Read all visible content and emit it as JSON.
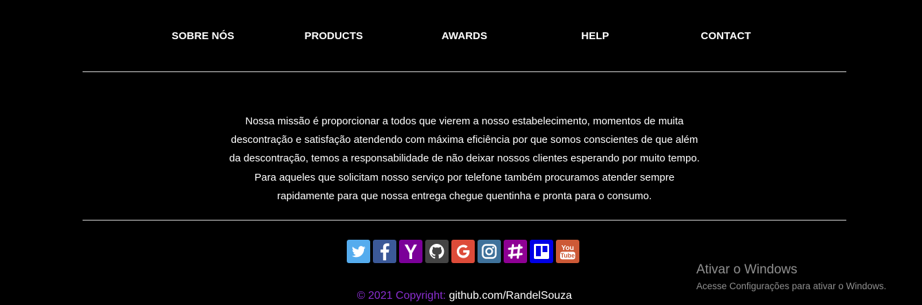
{
  "nav": {
    "items": [
      {
        "label": "SOBRE NÓS"
      },
      {
        "label": "PRODUCTS"
      },
      {
        "label": "AWARDS"
      },
      {
        "label": "HELP"
      },
      {
        "label": "CONTACT"
      }
    ]
  },
  "mission": {
    "lines": [
      "Nossa missão é proporcionar a todos que vierem a nosso estabelecimento, momentos de muita",
      "descontração e satisfação atendendo com máxima eficiência por que somos conscientes de que além",
      "da descontração, temos a responsabilidade de não deixar nossos clientes esperando por muito tempo.",
      "Para aqueles que solicitam nosso serviço por telefone também procuramos atender sempre",
      "rapidamente para que nossa entrega chegue quentinha e pronta para o consumo."
    ]
  },
  "social": {
    "icons": [
      {
        "name": "twitter-icon",
        "color": "#55acee"
      },
      {
        "name": "facebook-icon",
        "color": "#3b5998"
      },
      {
        "name": "yahoo-icon",
        "color": "#7b0099"
      },
      {
        "name": "github-icon",
        "color": "#444444"
      },
      {
        "name": "google-icon",
        "color": "#dd4b39"
      },
      {
        "name": "instagram-icon",
        "color": "#3f729b"
      },
      {
        "name": "slack-icon",
        "color": "#8e0094"
      },
      {
        "name": "trello-icon",
        "color": "#0000e6"
      },
      {
        "name": "youtube-icon",
        "color": "#cd5936"
      }
    ]
  },
  "footer": {
    "copyright_prefix": "© 2021 Copyright:",
    "link_text": "github.com/RandelSouza"
  },
  "windows_watermark": {
    "title": "Ativar o Windows",
    "subtitle": "Acesse Configurações para ativar o Windows."
  }
}
